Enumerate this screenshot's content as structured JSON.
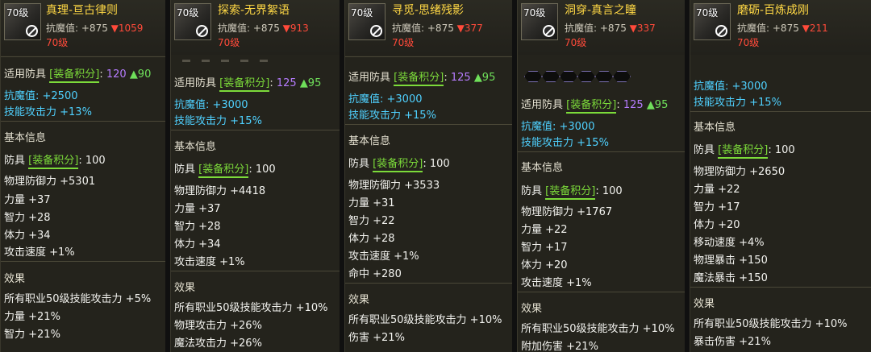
{
  "common": {
    "resist_label": "抗魔值:",
    "level_badge": "70级",
    "level_req": "70级",
    "slot_prefix": "适用防具",
    "tag_label": "[装备积分]",
    "colon": ":",
    "armor_label": "防具",
    "basic_info": "基本信息",
    "effect": "效果"
  },
  "cards": [
    {
      "title": "真理-亘古律则",
      "resist_base": "+875",
      "resist_down": "▼1059",
      "score": "120",
      "score_up": "▲90",
      "bonus1": "抗魔值: +2500",
      "bonus2": "技能攻击力 +13%",
      "armor_score": ": 100",
      "stats": [
        "物理防御力 +5301",
        "力量 +37",
        "智力 +28",
        "体力 +34",
        "攻击速度 +1%"
      ],
      "effects": [
        "所有职业50级技能攻击力 +5%",
        "力量 +21%",
        "智力 +21%"
      ]
    },
    {
      "title": "探索-无界絮语",
      "resist_base": "+875",
      "resist_down": "▼913",
      "score": "125",
      "score_up": "▲95",
      "bonus1": "抗魔值: +3000",
      "bonus2": "技能攻击力 +15%",
      "armor_score": ": 100",
      "stats": [
        "物理防御力 +4418",
        "力量 +37",
        "智力 +28",
        "体力 +34",
        "攻击速度 +1%"
      ],
      "effects": [
        "所有职业50级技能攻击力 +10%",
        "物理攻击力 +26%",
        "魔法攻击力 +26%"
      ]
    },
    {
      "title": "寻觅-思绪残影",
      "resist_base": "+875",
      "resist_down": "▼377",
      "score": "125",
      "score_up": "▲95",
      "bonus1": "抗魔值: +3000",
      "bonus2": "技能攻击力 +15%",
      "armor_score": ": 100",
      "stats": [
        "物理防御力 +3533",
        "力量 +31",
        "智力 +22",
        "体力 +28",
        "攻击速度 +1%",
        "命中 +280"
      ],
      "effects": [
        "所有职业50级技能攻击力 +10%",
        "伤害 +21%"
      ]
    },
    {
      "title": "洞穿-真言之瞳",
      "resist_base": "+875",
      "resist_down": "▼337",
      "score": "125",
      "score_up": "▲95",
      "bonus1": "抗魔值: +3000",
      "bonus2": "技能攻击力 +15%",
      "armor_score": ": 100",
      "stats": [
        "物理防御力 +1767",
        "力量 +22",
        "智力 +17",
        "体力 +20",
        "攻击速度 +1%"
      ],
      "effects": [
        "所有职业50级技能攻击力 +10%",
        "附加伤害 +21%"
      ]
    },
    {
      "title": "磨砺-百炼成刚",
      "resist_base": "+875",
      "resist_down": "▼211",
      "bonus1": "抗魔值: +3000",
      "bonus2": "技能攻击力 +15%",
      "armor_score": ": 100",
      "stats": [
        "物理防御力 +2650",
        "力量 +22",
        "智力 +17",
        "体力 +20",
        "移动速度 +4%",
        "物理暴击 +150",
        "魔法暴击 +150"
      ],
      "effects": [
        "所有职业50级技能攻击力 +10%",
        "暴击伤害 +21%"
      ]
    }
  ]
}
